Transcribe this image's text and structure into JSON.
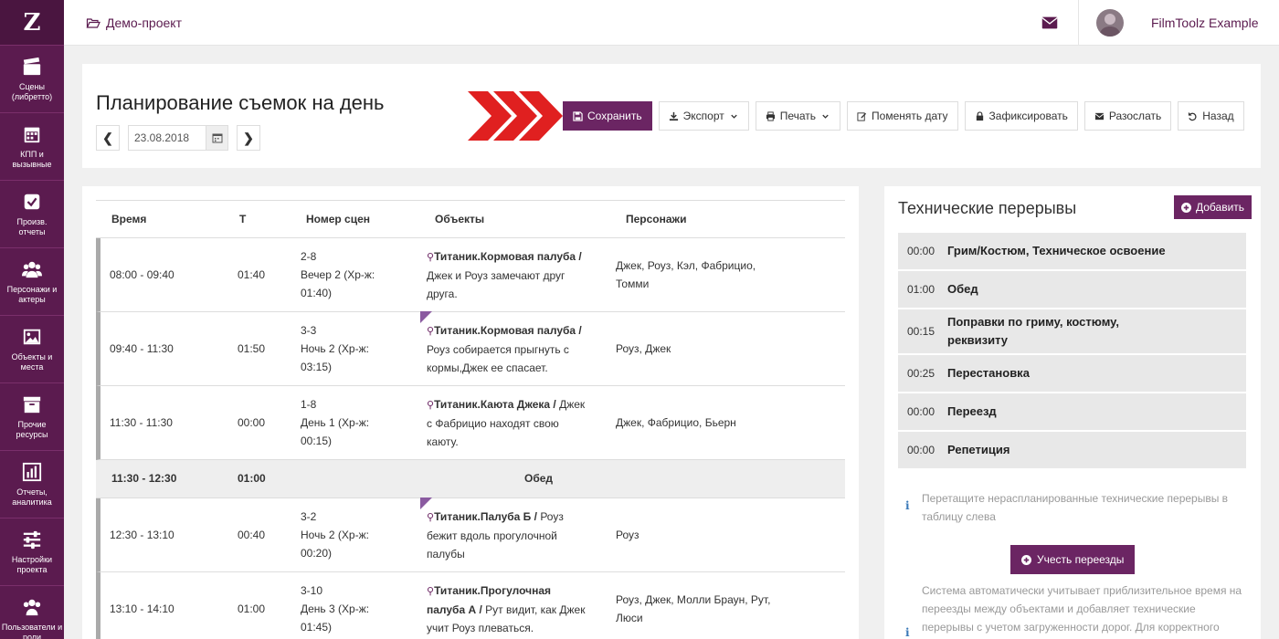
{
  "sidebar": {
    "logo": "Z",
    "items": [
      {
        "label": "Сцены\n(либретто)",
        "icon": "clapperboard-icon"
      },
      {
        "label": "КПП и\nвызывные",
        "icon": "calendar-icon"
      },
      {
        "label": "Произв.\nотчеты",
        "icon": "checkbox-icon"
      },
      {
        "label": "Персонажи и\nактеры",
        "icon": "users-icon"
      },
      {
        "label": "Объекты и\nместа",
        "icon": "image-icon"
      },
      {
        "label": "Прочие\nресурсы",
        "icon": "archive-icon"
      },
      {
        "label": "Отчеты,\nаналитика",
        "icon": "bar-chart-icon"
      },
      {
        "label": "Настройки\nпроекта",
        "icon": "sliders-icon"
      },
      {
        "label": "Пользователи и\nроли",
        "icon": "users-icon"
      }
    ]
  },
  "topbar": {
    "project": "Демо-проект",
    "username": "FilmToolz Example"
  },
  "header": {
    "title": "Планирование съемок на день",
    "date": "23.08.2018",
    "prev": "❮",
    "next": "❯",
    "buttons": {
      "save": "Сохранить",
      "export": "Экспорт",
      "print": "Печать",
      "change_date": "Поменять дату",
      "lock": "Зафиксировать",
      "send": "Разослать",
      "back": "Назад"
    }
  },
  "table": {
    "columns": [
      "Время",
      "Т",
      "Номер сцен",
      "Объекты",
      "Персонажи"
    ],
    "rows": [
      {
        "time": "08:00 - 09:40",
        "t": "01:40",
        "scene_num": "2-8",
        "scene_desc": "Вечер 2 (Хр-ж: 01:40)",
        "object_name": "Титаник.Кормовая палуба /",
        "object_desc": "Джек и Роуз замечают друг друга.",
        "characters": "Джек, Роуз, Кэл, Фабрицио, Томми"
      },
      {
        "time": "09:40 - 11:30",
        "t": "01:50",
        "scene_num": "3-3",
        "scene_desc": "Ночь 2 (Хр-ж: 03:15)",
        "object_name": "Титаник.Кормовая палуба /",
        "object_desc": "Роуз собирается прыгнуть с кормы,Джек ее спасает.",
        "characters": "Роуз, Джек"
      },
      {
        "time": "11:30 - 11:30",
        "t": "00:00",
        "scene_num": "1-8",
        "scene_desc": "День 1 (Хр-ж: 00:15)",
        "object_name": "Титаник.Каюта Джека /",
        "object_desc": "Джек с Фабрицио находят свою каюту.",
        "characters": "Джек, Фабрицио, Бьерн"
      },
      {
        "time": "12:30 - 13:10",
        "t": "00:40",
        "scene_num": "3-2",
        "scene_desc": "Ночь 2 (Хр-ж: 00:20)",
        "object_name": "Титаник.Палуба Б /",
        "object_desc": "Роуз бежит вдоль прогулочной палубы",
        "characters": "Роуз"
      },
      {
        "time": "13:10 - 14:10",
        "t": "01:00",
        "scene_num": "3-10",
        "scene_desc": "День 3 (Хр-ж: 01:45)",
        "object_name": "Титаник.Прогулочная палуба А /",
        "object_desc": "Рут видит, как Джек учит Роуз плеваться.",
        "characters": "Роуз, Джек, Молли Браун, Рут, Люси"
      }
    ],
    "lunch": {
      "time": "11:30 - 12:30",
      "t": "01:00",
      "label": "Обед"
    }
  },
  "tech": {
    "title": "Технические перерывы",
    "add": "Добавить",
    "items": [
      {
        "dur": "00:00",
        "name": "Грим/Костюм, Техническое освоение"
      },
      {
        "dur": "01:00",
        "name": "Обед"
      },
      {
        "dur": "00:15",
        "name": "Поправки по гриму, костюму, реквизиту"
      },
      {
        "dur": "00:25",
        "name": "Перестановка"
      },
      {
        "dur": "00:00",
        "name": "Переезд"
      },
      {
        "dur": "00:00",
        "name": "Репетиция"
      }
    ],
    "hint": "Перетащите нераспланированные технические перерывы в таблицу слева",
    "travel_btn": "Учесть переезды",
    "info": "Система автоматически учитывает приблизительное время на переезды между объектами и добавляет технические перерывы с учетом загруженности дорог. Для корректного"
  },
  "colors": {
    "brand": "#6b2563",
    "sidebar": "#5b1b4f",
    "arrow": "#e02020"
  }
}
